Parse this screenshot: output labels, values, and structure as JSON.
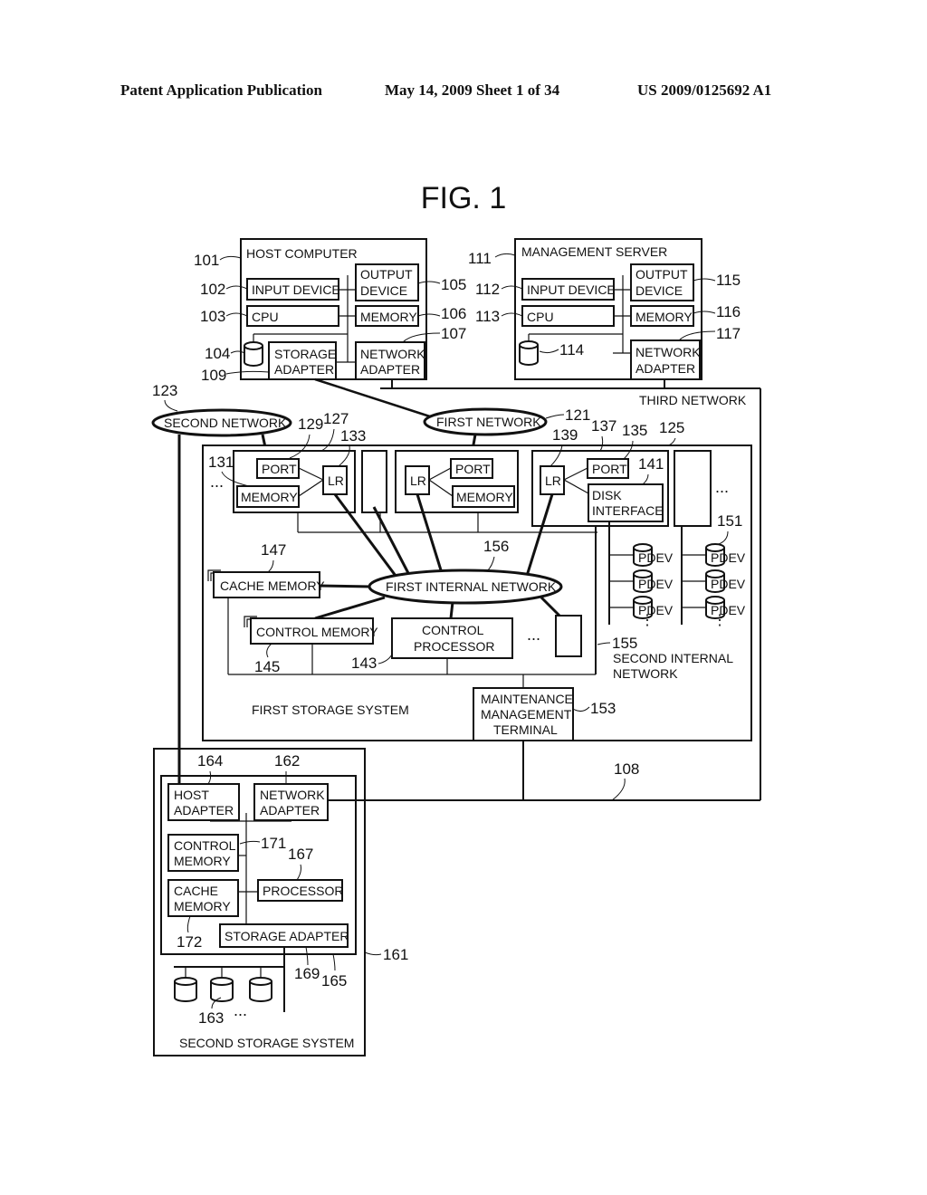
{
  "header": {
    "publication": "Patent Application Publication",
    "date_sheet": "May 14, 2009  Sheet 1 of 34",
    "patent_number": "US 2009/0125692 A1"
  },
  "figure": {
    "title": "FIG. 1",
    "host_computer": {
      "title": "HOST COMPUTER",
      "input_device": "INPUT DEVICE",
      "output_device_1": "OUTPUT",
      "output_device_2": "DEVICE",
      "cpu": "CPU",
      "memory": "MEMORY",
      "storage_adapter_1": "STORAGE",
      "storage_adapter_2": "ADAPTER",
      "network_adapter_1": "NETWORK",
      "network_adapter_2": "ADAPTER",
      "refs": {
        "host": "101",
        "input": "102",
        "cpu": "103",
        "disk": "104",
        "output": "105",
        "memory": "106",
        "netadapter": "107",
        "storadapter": "109"
      }
    },
    "management_server": {
      "title": "MANAGEMENT SERVER",
      "input_device": "INPUT DEVICE",
      "output_device_1": "OUTPUT",
      "output_device_2": "DEVICE",
      "cpu": "CPU",
      "memory": "MEMORY",
      "network_adapter_1": "NETWORK",
      "network_adapter_2": "ADAPTER",
      "refs": {
        "server": "111",
        "input": "112",
        "cpu": "113",
        "disk": "114",
        "output": "115",
        "memory": "116",
        "netadapter": "117"
      }
    },
    "networks": {
      "third": "THIRD NETWORK",
      "second": "SECOND NETWORK",
      "first": "FIRST NETWORK",
      "first_internal": "FIRST INTERNAL NETWORK",
      "second_internal_1": "SECOND INTERNAL",
      "second_internal_2": "NETWORK",
      "refs": {
        "second": "123",
        "first": "121",
        "first_internal": "156",
        "second_internal": "155",
        "third_line": "108"
      }
    },
    "first_storage": {
      "title": "FIRST STORAGE SYSTEM",
      "port": "PORT",
      "memory": "MEMORY",
      "lr": "LR",
      "disk_interface_1": "DISK",
      "disk_interface_2": "INTERFACE",
      "cache_memory": "CACHE MEMORY",
      "control_memory": "CONTROL MEMORY",
      "control_processor_1": "CONTROL",
      "control_processor_2": "PROCESSOR",
      "pdev": "PDEV",
      "maint_1": "MAINTENANCE",
      "maint_2": "MANAGEMENT",
      "maint_3": "TERMINAL",
      "ellipsis": "...",
      "refs": {
        "system": "125",
        "chp": "127",
        "port1": "129",
        "mem1": "131",
        "lr1": "133",
        "port2": "135",
        "dkp": "137",
        "lr2": "139",
        "diskif": "141",
        "ctrlproc": "143",
        "ctrlmem": "145",
        "cache": "147",
        "pdev": "151",
        "maint": "153"
      }
    },
    "second_storage": {
      "title": "SECOND STORAGE SYSTEM",
      "host_adapter_1": "HOST",
      "host_adapter_2": "ADAPTER",
      "network_adapter_1": "NETWORK",
      "network_adapter_2": "ADAPTER",
      "control_memory_1": "CONTROL",
      "control_memory_2": "MEMORY",
      "cache_memory_1": "CACHE",
      "cache_memory_2": "MEMORY",
      "processor": "PROCESSOR",
      "storage_adapter": "STORAGE ADAPTER",
      "ellipsis": "...",
      "refs": {
        "system": "161",
        "netadapter": "162",
        "disks": "163",
        "hostadapter": "164",
        "controller": "165",
        "processor": "167",
        "storadapter": "169",
        "ctrlmem": "171",
        "cache": "172"
      }
    }
  }
}
